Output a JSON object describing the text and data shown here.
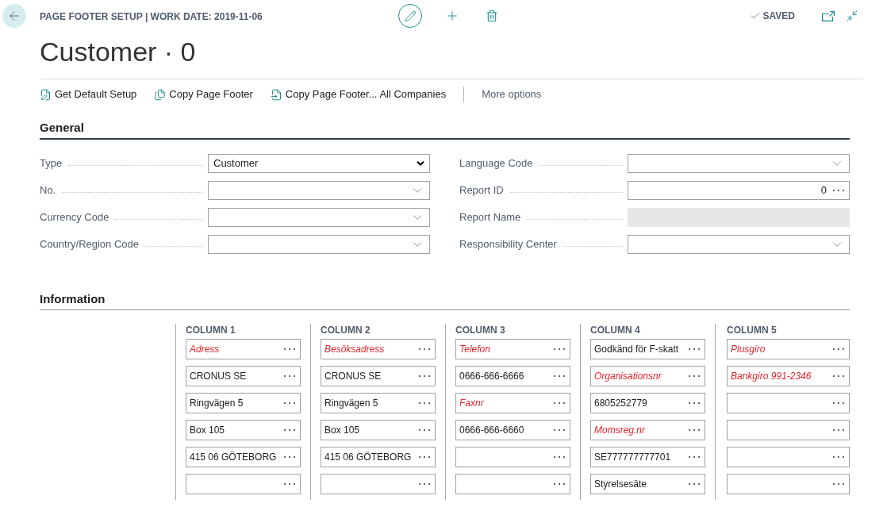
{
  "header": {
    "breadcrumb": "PAGE FOOTER SETUP | WORK DATE: 2019-11-06",
    "status": "SAVED"
  },
  "title": "Customer · 0",
  "actions": [
    {
      "kind": "setup",
      "label": "Get Default Setup"
    },
    {
      "kind": "copy",
      "label": "Copy Page Footer"
    },
    {
      "kind": "copy_all",
      "label": "Copy Page Footer... All Companies"
    }
  ],
  "more_options": "More options",
  "general": {
    "title": "General",
    "left_fields": [
      {
        "label": "Type",
        "kind": "select",
        "value": "Customer"
      },
      {
        "label": "No.",
        "kind": "lookup"
      },
      {
        "label": "Currency Code",
        "kind": "lookup"
      },
      {
        "label": "Country/Region Code",
        "kind": "lookup"
      }
    ],
    "right_fields": [
      {
        "label": "Language Code",
        "kind": "lookup"
      },
      {
        "label": "Report ID",
        "kind": "assist",
        "value": "0"
      },
      {
        "label": "Report Name",
        "kind": "readonly"
      },
      {
        "label": "Responsibility Center",
        "kind": "lookup"
      }
    ]
  },
  "information": {
    "title": "Information",
    "columns": [
      {
        "header": "COLUMN 1",
        "cells": [
          {
            "placeholder": "Adress"
          },
          {
            "value": "CRONUS SE"
          },
          {
            "value": "Ringvägen 5"
          },
          {
            "value": "Box 105"
          },
          {
            "value": "415 06 GÖTEBORG"
          },
          {}
        ]
      },
      {
        "header": "COLUMN 2",
        "cells": [
          {
            "placeholder": "Besöksadress"
          },
          {
            "value": "CRONUS SE"
          },
          {
            "value": "Ringvägen 5"
          },
          {
            "value": "Box 105"
          },
          {
            "value": "415 06 GÖTEBORG"
          },
          {}
        ]
      },
      {
        "header": "COLUMN 3",
        "cells": [
          {
            "placeholder": "Telefon"
          },
          {
            "value": "0666-666-6666"
          },
          {
            "placeholder": "Faxnr"
          },
          {
            "value": "0666-666-6660"
          },
          {},
          {}
        ]
      },
      {
        "header": "COLUMN 4",
        "cells": [
          {
            "value": "Godkänd för F-skatt"
          },
          {
            "placeholder": "Organisationsnr"
          },
          {
            "value": "6805252779"
          },
          {
            "placeholder": "Momsreg.nr"
          },
          {
            "value": "SE777777777701"
          },
          {
            "value": "Styrelsesäte"
          }
        ]
      },
      {
        "header": "COLUMN 5",
        "cells": [
          {
            "placeholder": "Plusgiro"
          },
          {
            "placeholder": "Bankgiro 991-2346"
          },
          {},
          {},
          {},
          {}
        ]
      }
    ]
  }
}
